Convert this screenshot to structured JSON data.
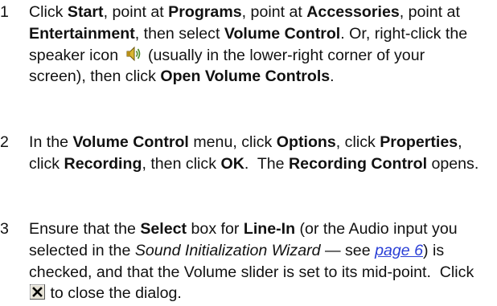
{
  "steps": [
    {
      "number": "1",
      "t1": "Click ",
      "b1": "Start",
      "t2": ", point at ",
      "b2": "Programs",
      "t3": ", point at ",
      "b3": "Accessories",
      "t4": ", point at ",
      "b4": "Entertainment",
      "t5": ", then select ",
      "b5": "Volume Control",
      "t6": ". Or, right-click the speaker icon ",
      "t7": " (usually in the lower-right corner of your screen), then click ",
      "b6": "Open Volume Controls",
      "t8": "."
    },
    {
      "number": "2",
      "t1": "In the ",
      "b1": "Volume Control",
      "t2": " menu, click ",
      "b2": "Options",
      "t3": ", click ",
      "b3": "Properties",
      "t4": ", click ",
      "b4": "Recording",
      "t5": ", then click ",
      "b5": "OK",
      "t6": ".  The ",
      "b6": "Recording Control",
      "t7": " opens."
    },
    {
      "number": "3",
      "t1": "Ensure that the ",
      "b1": "Select",
      "t2": " box for ",
      "b2": "Line-In",
      "t3": " (or the Audio input you selected in the ",
      "i1": "Sound Initialization Wizard",
      "t4": " — see ",
      "link": "page 6",
      "t5": ") is checked, and that the Volume slider is set to its mid-point.  Click ",
      "t6": " to close the dialog."
    }
  ],
  "icons": {
    "speaker": "speaker-icon",
    "close": "close-icon"
  },
  "colors": {
    "text": "#111111",
    "link": "#2a3fd6"
  }
}
